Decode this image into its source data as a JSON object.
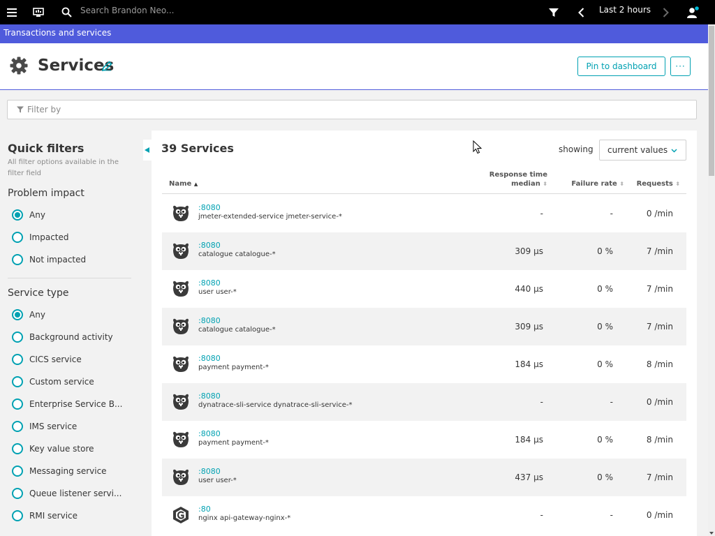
{
  "topbar": {
    "search_placeholder": "Search Brandon Neo...",
    "timeframe": "Last 2 hours",
    "icons": [
      "menu-icon",
      "monitor-icon",
      "search-icon",
      "filter-icon",
      "chevron-left-icon",
      "chevron-right-icon",
      "user-icon"
    ]
  },
  "breadcrumb": {
    "label": "Transactions and services"
  },
  "header": {
    "title": "Services",
    "pin_label": "Pin to dashboard",
    "more_label": "···"
  },
  "filter": {
    "placeholder": "Filter by"
  },
  "quick_filters": {
    "title": "Quick filters",
    "subtitle": "All filter options available in the filter field",
    "problem_impact": {
      "title": "Problem impact",
      "options": [
        "Any",
        "Impacted",
        "Not impacted"
      ],
      "selected": "Any"
    },
    "service_type": {
      "title": "Service type",
      "options": [
        "Any",
        "Background activity",
        "CICS service",
        "Custom service",
        "Enterprise Service B...",
        "IMS service",
        "Key value store",
        "Messaging service",
        "Queue listener servi...",
        "RMI service"
      ],
      "selected": "Any"
    }
  },
  "main": {
    "count_label": "39 Services",
    "showing_label": "showing",
    "select_value": "current values",
    "columns": {
      "name": "Name",
      "response_line1": "Response time",
      "response_line2": "median",
      "failure": "Failure rate",
      "requests": "Requests"
    },
    "rows": [
      {
        "port": ":8080",
        "name": "jmeter-extended-service jmeter-service-*",
        "response": "-",
        "failure": "-",
        "requests": "0 /min",
        "icon": "go-gopher-icon"
      },
      {
        "port": ":8080",
        "name": "catalogue catalogue-*",
        "response": "309 µs",
        "failure": "0 %",
        "requests": "7 /min",
        "icon": "go-gopher-icon"
      },
      {
        "port": ":8080",
        "name": "user user-*",
        "response": "440 µs",
        "failure": "0 %",
        "requests": "7 /min",
        "icon": "go-gopher-icon"
      },
      {
        "port": ":8080",
        "name": "catalogue catalogue-*",
        "response": "309 µs",
        "failure": "0 %",
        "requests": "7 /min",
        "icon": "go-gopher-icon"
      },
      {
        "port": ":8080",
        "name": "payment payment-*",
        "response": "184 µs",
        "failure": "0 %",
        "requests": "8 /min",
        "icon": "go-gopher-icon"
      },
      {
        "port": ":8080",
        "name": "dynatrace-sli-service dynatrace-sli-service-*",
        "response": "-",
        "failure": "-",
        "requests": "0 /min",
        "icon": "go-gopher-icon"
      },
      {
        "port": ":8080",
        "name": "payment payment-*",
        "response": "184 µs",
        "failure": "0 %",
        "requests": "8 /min",
        "icon": "go-gopher-icon"
      },
      {
        "port": ":8080",
        "name": "user user-*",
        "response": "437 µs",
        "failure": "0 %",
        "requests": "7 /min",
        "icon": "go-gopher-icon"
      },
      {
        "port": ":80",
        "name": "nginx api-gateway-nginx-*",
        "response": "-",
        "failure": "-",
        "requests": "0 /min",
        "icon": "nginx-icon"
      }
    ]
  },
  "colors": {
    "topbar": "#000000",
    "breadcrumb": "#4f5bdc",
    "accent": "#00a1b2"
  }
}
